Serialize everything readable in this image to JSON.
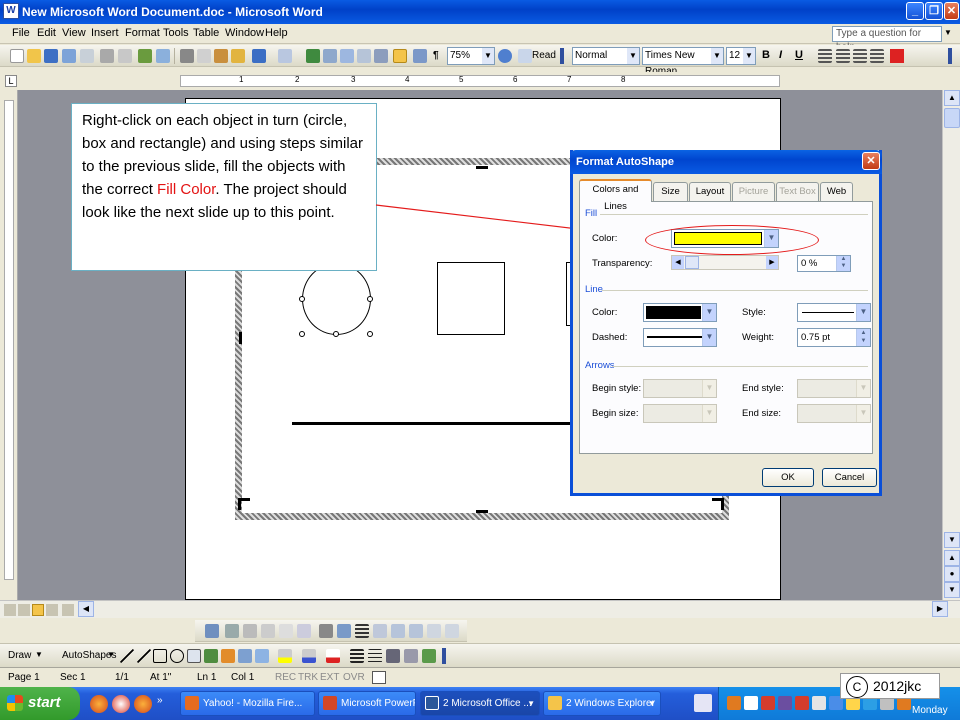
{
  "window": {
    "title": "New Microsoft Word Document.doc - Microsoft Word",
    "minimize": "_",
    "restore": "❐",
    "close": "✕"
  },
  "menu": {
    "items": [
      "File",
      "Edit",
      "View",
      "Insert",
      "Format",
      "Tools",
      "Table",
      "Window",
      "Help"
    ],
    "ask_placeholder": "Type a question for help"
  },
  "standard_toolbar": {
    "zoom": "75%",
    "read_label": "Read"
  },
  "formatting_toolbar": {
    "style": "Normal",
    "font": "Times New Roman",
    "size": "12",
    "bold": "B",
    "italic": "I",
    "underline": "U"
  },
  "ruler": {
    "marks": [
      "1",
      "2",
      "3",
      "4",
      "5",
      "6",
      "7",
      "8"
    ]
  },
  "callout": {
    "text_before": "Right-click on each object in turn (circle, box and rectangle) and using steps similar to the previous slide, fill the objects with the correct ",
    "highlight": "Fill Color",
    "text_after": ". The project should look like the next slide up to this point."
  },
  "dialog": {
    "title": "Format AutoShape",
    "tabs": [
      "Colors and Lines",
      "Size",
      "Layout",
      "Picture",
      "Text Box",
      "Web"
    ],
    "active_tab": "Colors and Lines",
    "fill_group": "Fill",
    "fill_color_label": "Color:",
    "fill_color_value": "#ffff00",
    "transparency_label": "Transparency:",
    "transparency_value": "0 %",
    "line_group": "Line",
    "line_color_label": "Color:",
    "line_color_value": "#000000",
    "style_label": "Style:",
    "dashed_label": "Dashed:",
    "weight_label": "Weight:",
    "weight_value": "0.75 pt",
    "arrows_group": "Arrows",
    "begin_style_label": "Begin style:",
    "end_style_label": "End style:",
    "begin_size_label": "Begin size:",
    "end_size_label": "End size:",
    "ok": "OK",
    "cancel": "Cancel"
  },
  "draw_toolbar": {
    "draw": "Draw",
    "autoshapes": "AutoShapes"
  },
  "status": {
    "page": "Page 1",
    "sec": "Sec 1",
    "pages": "1/1",
    "at": "At 1\"",
    "ln": "Ln 1",
    "col": "Col 1",
    "rec": "REC",
    "trk": "TRK",
    "ext": "EXT",
    "ovr": "OVR"
  },
  "taskbar": {
    "start": "start",
    "tasks": [
      "Yahoo! - Mozilla Fire...",
      "Microsoft PowerPoin...",
      "2 Microsoft Office ...",
      "2 Windows Explorer"
    ],
    "clock_day": "Monday"
  },
  "copyright": {
    "symbol": "C",
    "text": "2012jkc"
  }
}
